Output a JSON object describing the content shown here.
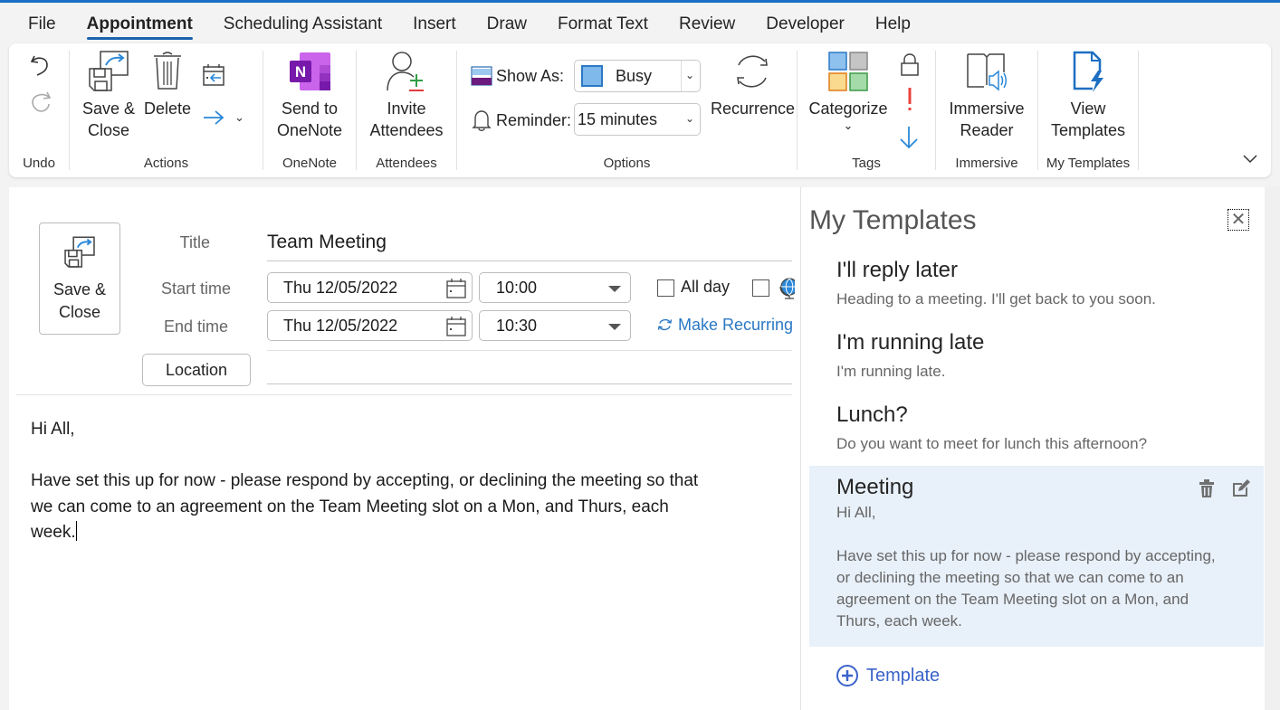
{
  "menu": {
    "tabs": [
      {
        "label": "File",
        "active": false
      },
      {
        "label": "Appointment",
        "active": true
      },
      {
        "label": "Scheduling Assistant",
        "active": false
      },
      {
        "label": "Insert",
        "active": false
      },
      {
        "label": "Draw",
        "active": false
      },
      {
        "label": "Format Text",
        "active": false
      },
      {
        "label": "Review",
        "active": false
      },
      {
        "label": "Developer",
        "active": false
      },
      {
        "label": "Help",
        "active": false
      }
    ]
  },
  "ribbon": {
    "groups": {
      "undo": "Undo",
      "actions": "Actions",
      "onenote": "OneNote",
      "attendees": "Attendees",
      "options": "Options",
      "tags": "Tags",
      "immersive": "Immersive",
      "my_templates": "My Templates"
    },
    "buttons": {
      "save_close_line1": "Save &",
      "save_close_line2": "Close",
      "delete": "Delete",
      "send_onenote_line1": "Send to",
      "send_onenote_line2": "OneNote",
      "invite_line1": "Invite",
      "invite_line2": "Attendees",
      "recurrence": "Recurrence",
      "categorize": "Categorize",
      "immersive_line1": "Immersive",
      "immersive_line2": "Reader",
      "view_templates_line1": "View",
      "view_templates_line2": "Templates"
    },
    "options": {
      "show_as_label": "Show As:",
      "show_as_value": "Busy",
      "reminder_label": "Reminder:",
      "reminder_value": "15 minutes"
    }
  },
  "form": {
    "save_close_line1": "Save &",
    "save_close_line2": "Close",
    "title_label": "Title",
    "title_value": "Team Meeting",
    "start_label": "Start time",
    "end_label": "End time",
    "start_date": "Thu 12/05/2022",
    "start_time": "10:00",
    "end_date": "Thu 12/05/2022",
    "end_time": "10:30",
    "all_day_label": "All day",
    "all_day_checked": false,
    "time_zone_checked": false,
    "make_recurring": "Make Recurring",
    "location_button": "Location",
    "location_value": "",
    "body_line1": "Hi All,",
    "body_para": "Have set this up for now - please respond by accepting, or declining the meeting so that\nwe can come to an agreement on the Team Meeting slot on a Mon, and Thurs, each\nweek."
  },
  "sidebar": {
    "title": "My Templates",
    "templates": [
      {
        "title": "I'll reply later",
        "body": "Heading to a meeting. I'll get back to you soon."
      },
      {
        "title": "I'm running late",
        "body": "I'm running late."
      },
      {
        "title": "Lunch?",
        "body": "Do you want to meet for lunch this afternoon?"
      },
      {
        "title": "Meeting",
        "body": "Hi All,\n\nHave set this up for now - please respond by accepting,\nor declining the meeting so that we can come to an\nagreement on the Team Meeting slot on a Mon, and\nThurs, each week.",
        "selected": true
      }
    ],
    "add_template_label": "Template"
  },
  "colors": {
    "accent": "#1a6fc4",
    "link": "#3a63c9",
    "selected_template_bg": "#e8f0f9",
    "busy_blue": "#7fb8ea"
  }
}
